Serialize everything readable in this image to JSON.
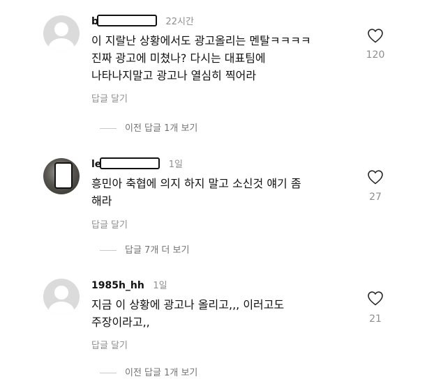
{
  "comments": [
    {
      "username": "b",
      "time": "22시간",
      "text_lines": [
        "이 지랄난 상황에서도 광고올리는 멘탈ㅋㅋㅋㅋ",
        "진짜 광고에 미쳤나? 다시는 대표팀에",
        "나타나지말고 광고나 열심히 찍어라"
      ],
      "reply_label": "답글 달기",
      "likes": "120",
      "view_replies": "이전 답글 1개 보기"
    },
    {
      "username": "le",
      "time": "1일",
      "text_lines": [
        "흥민아 축협에 의지 하지 말고 소신것  얘기 좀",
        "해라"
      ],
      "reply_label": "답글 달기",
      "likes": "27",
      "view_replies": "답글 7개 더 보기"
    },
    {
      "username": "1985h_hh",
      "time": "1일",
      "text_lines": [
        "지금 이 상황에 광고나 올리고,,, 이러고도",
        "주장이라고,,"
      ],
      "reply_label": "답글 달기",
      "likes": "21",
      "view_replies": "이전 답글 1개 보기"
    }
  ],
  "icons": {
    "avatar_default": "default-avatar-icon",
    "avatar_photo": "profile-photo-icon",
    "like": "heart-outline-icon"
  },
  "colors": {
    "text": "#111111",
    "secondary": "#8e8e8e",
    "avatar_bg": "#dbdbdb"
  }
}
